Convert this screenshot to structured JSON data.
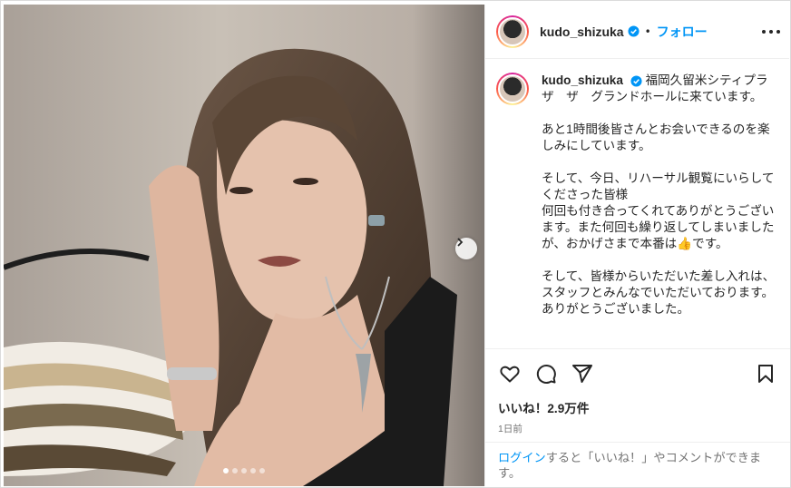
{
  "header": {
    "username": "kudo_shizuka",
    "separator": "•",
    "follow_label": "フォロー"
  },
  "caption": {
    "username": "kudo_shizuka",
    "paragraphs": [
      "福岡久留米シティプラザ　ザ　グランドホールに来ています。",
      "あと1時間後皆さんとお会いできるのを楽しみにしています。",
      "そして、今日、リハーサル観覧にいらしてくださった皆様\n何回も付き合ってくれてありがとうございます。また何回も繰り返してしまいましたが、おかげさまで本番は👍です。",
      "そして、皆様からいただいた差し入れは、スタッフとみんなでいただいております。ありがとうございました。"
    ]
  },
  "engagement": {
    "likes": "いいね！2.9万件",
    "time": "1日前"
  },
  "login_prompt": {
    "link": "ログイン",
    "text": "すると「いいね！」やコメントができます。"
  },
  "carousel": {
    "slides": 5,
    "active": 0
  },
  "icons": [
    "heart-icon",
    "comment-icon",
    "share-icon",
    "bookmark-icon",
    "more-icon",
    "verified-icon",
    "chevron-right-icon"
  ],
  "colors": {
    "accent": "#0095f6",
    "text": "#262626",
    "muted": "#737373",
    "border": "#efefef"
  }
}
